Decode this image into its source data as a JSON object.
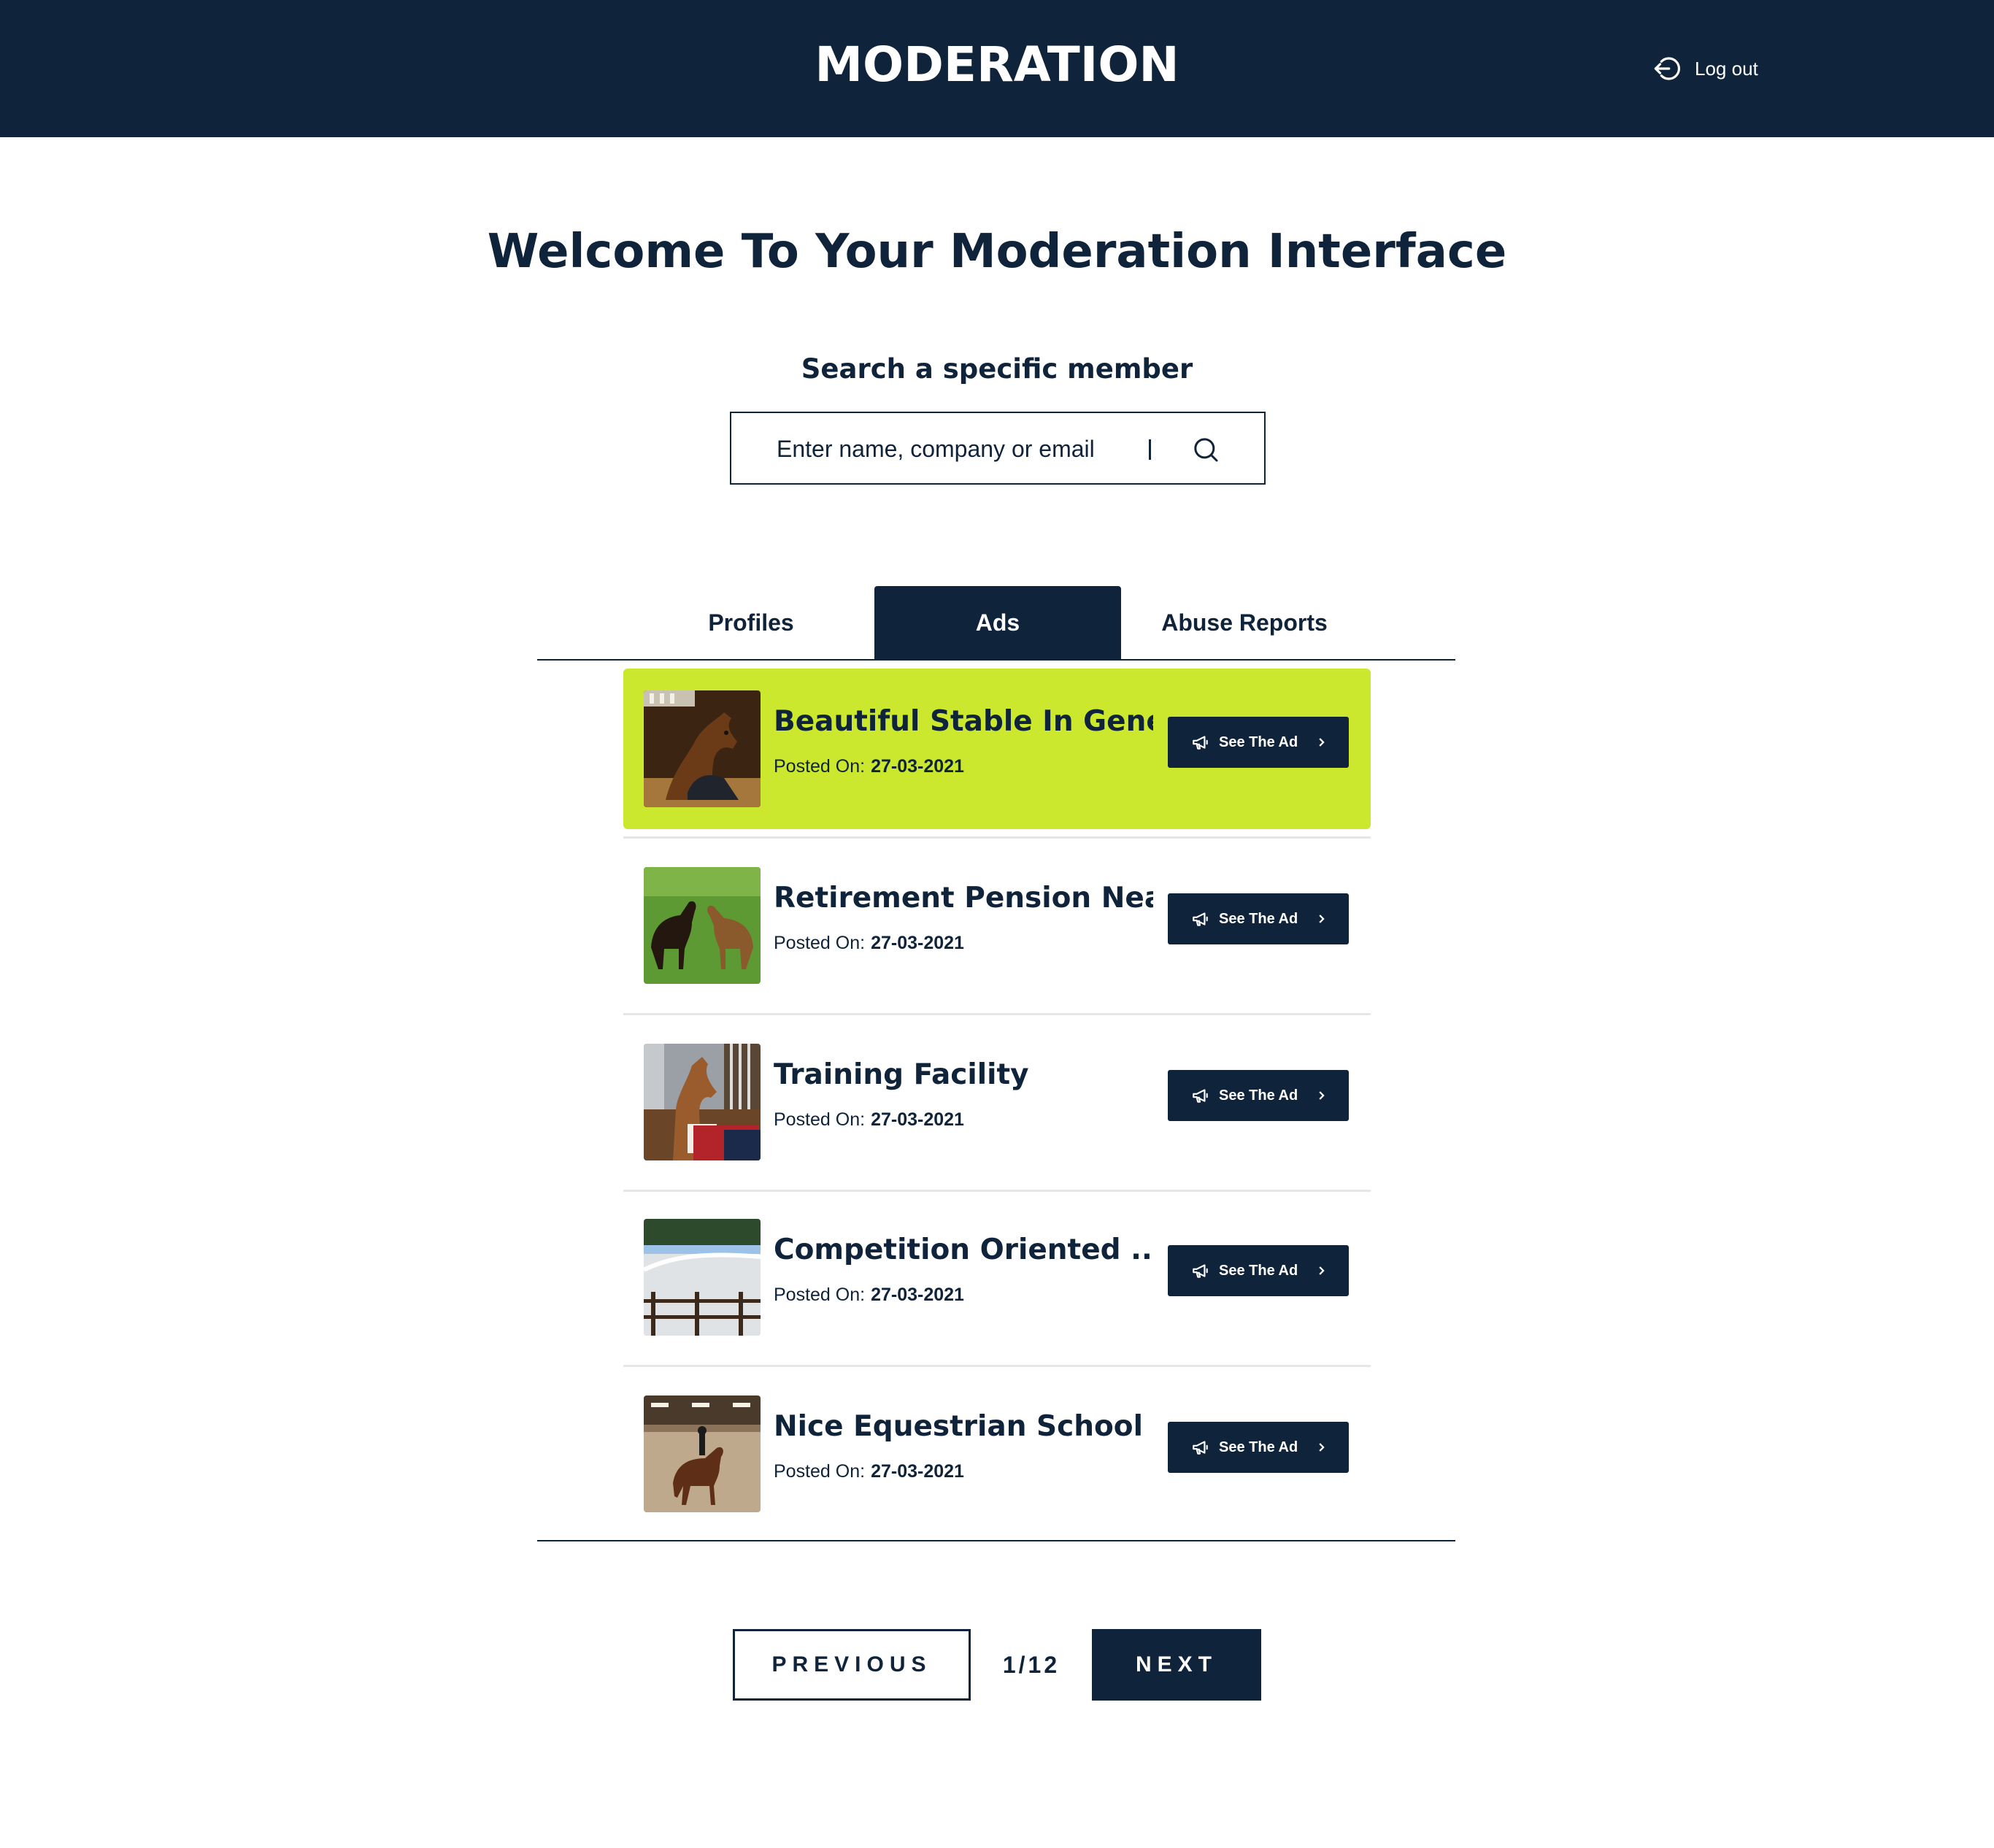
{
  "header": {
    "brand": "MODERATION",
    "logout_label": "Log out"
  },
  "main": {
    "welcome_title": "Welcome To Your Moderation Interface",
    "search_label": "Search a specific member",
    "search_placeholder": "Enter name, company or email"
  },
  "tabs": [
    {
      "label": "Profiles",
      "active": false
    },
    {
      "label": "Ads",
      "active": true
    },
    {
      "label": "Abuse Reports",
      "active": false
    }
  ],
  "ads": [
    {
      "title": "Beautiful Stable In Genevas...",
      "posted_label": "Posted On:",
      "date": "27-03-2021",
      "button": "See The Ad",
      "highlighted": true,
      "thumb_icon": "horse-in-stall-photo"
    },
    {
      "title": "Retirement Pension Near ...",
      "posted_label": "Posted On:",
      "date": "27-03-2021",
      "button": "See The Ad",
      "highlighted": false,
      "thumb_icon": "horses-in-pasture-photo"
    },
    {
      "title": "Training Facility",
      "posted_label": "Posted On:",
      "date": "27-03-2021",
      "button": "See The Ad",
      "highlighted": false,
      "thumb_icon": "horse-in-stable-photo"
    },
    {
      "title": "Competition Oriented ...",
      "posted_label": "Posted On:",
      "date": "27-03-2021",
      "button": "See The Ad",
      "highlighted": false,
      "thumb_icon": "arena-photo"
    },
    {
      "title": "Nice Equestrian School Ne ...",
      "posted_label": "Posted On:",
      "date": "27-03-2021",
      "button": "See The Ad",
      "highlighted": false,
      "thumb_icon": "indoor-riding-photo"
    }
  ],
  "pagination": {
    "previous_label": "PREVIOUS",
    "page_indicator": "1/12",
    "next_label": "NEXT"
  },
  "colors": {
    "navy": "#0f233a",
    "highlight": "#cbe82e",
    "separator": "#e6e6e6"
  }
}
